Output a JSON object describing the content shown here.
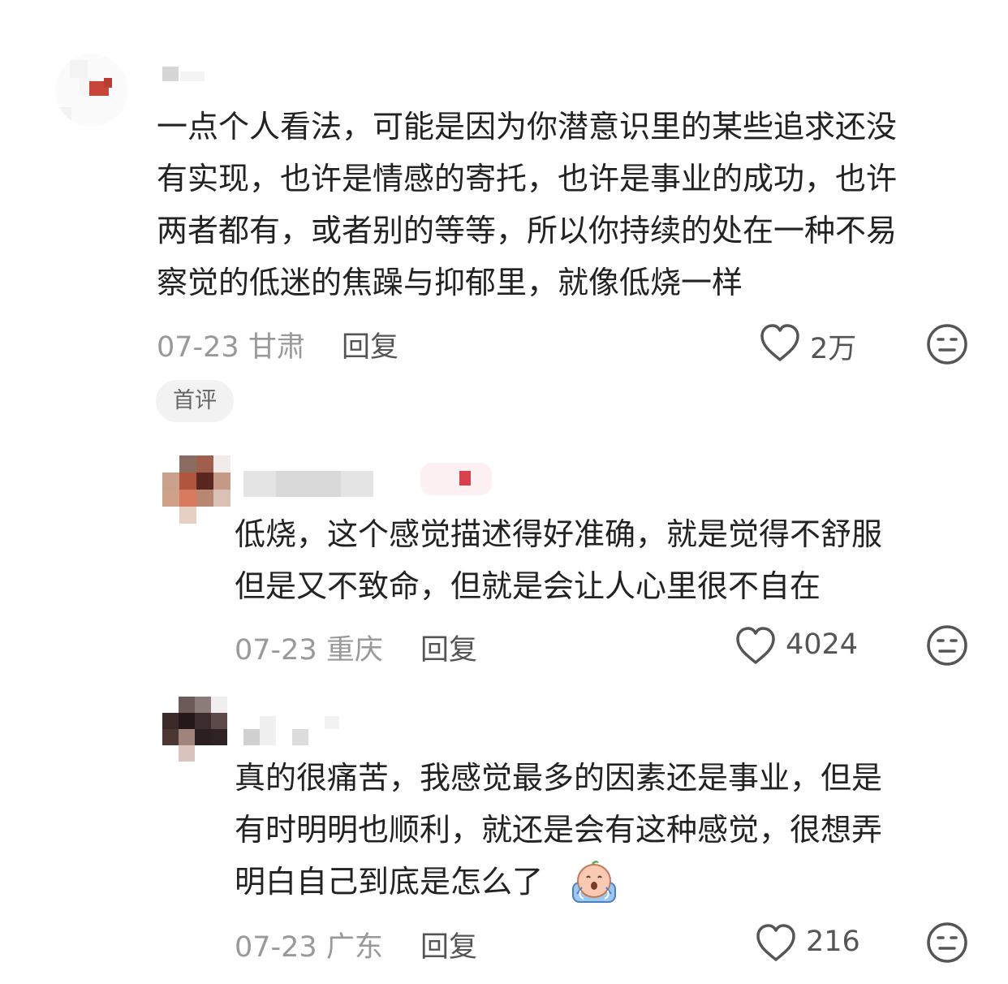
{
  "comments": [
    {
      "lines": [
        "一点个人看法，可能是因为你潜意识里的某些追求还没",
        "有实现，也许是情感的寄托，也许是事业的成功，也许",
        "两者都有，或者别的等等，所以你持续的处在一种不易",
        "察觉的低迷的焦躁与抑郁里，就像低烧一样"
      ],
      "date_location": "07-23 甘肃",
      "reply_label": "回复",
      "likes": "2万",
      "badge": "首评"
    },
    {
      "lines": [
        "低烧，这个感觉描述得好准确，就是觉得不舒服",
        "但是又不致命，但就是会让人心里很不自在"
      ],
      "date_location": "07-23 重庆",
      "reply_label": "回复",
      "likes": "4024"
    },
    {
      "lines": [
        "真的很痛苦，我感觉最多的因素还是事业，但是",
        "有时明明也顺利，就还是会有这种感觉，很想弄",
        "明白自己到底是怎么了"
      ],
      "date_location": "07-23 广东",
      "reply_label": "回复",
      "likes": "216",
      "emoji": "crying-face-emoji"
    }
  ],
  "colors": {
    "text": "#222222",
    "meta": "#999999",
    "icon": "#555555",
    "badge_bg": "#f2f2f2"
  }
}
